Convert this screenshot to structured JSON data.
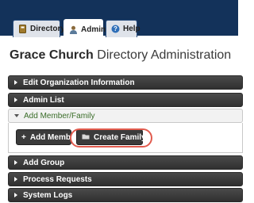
{
  "nav": {
    "tabs": [
      {
        "label": "Directory",
        "icon": "directory-icon"
      },
      {
        "label": "Admin",
        "icon": "user-icon"
      },
      {
        "label": "Help",
        "icon": "help-icon"
      }
    ]
  },
  "page": {
    "title_bold": "Grace Church",
    "title_rest": " Directory Administration"
  },
  "sections": [
    {
      "label": "Edit Organization Information"
    },
    {
      "label": "Admin List"
    },
    {
      "label": "Add Member/Family"
    },
    {
      "label": "Add Group"
    },
    {
      "label": "Process Requests"
    },
    {
      "label": "System Logs"
    }
  ],
  "actions": {
    "add_member": "Add Member",
    "create_family": "Create Family"
  },
  "colors": {
    "topbar": "#13325a",
    "highlight": "#e15b4e",
    "open_section_text": "#3a6d29"
  }
}
